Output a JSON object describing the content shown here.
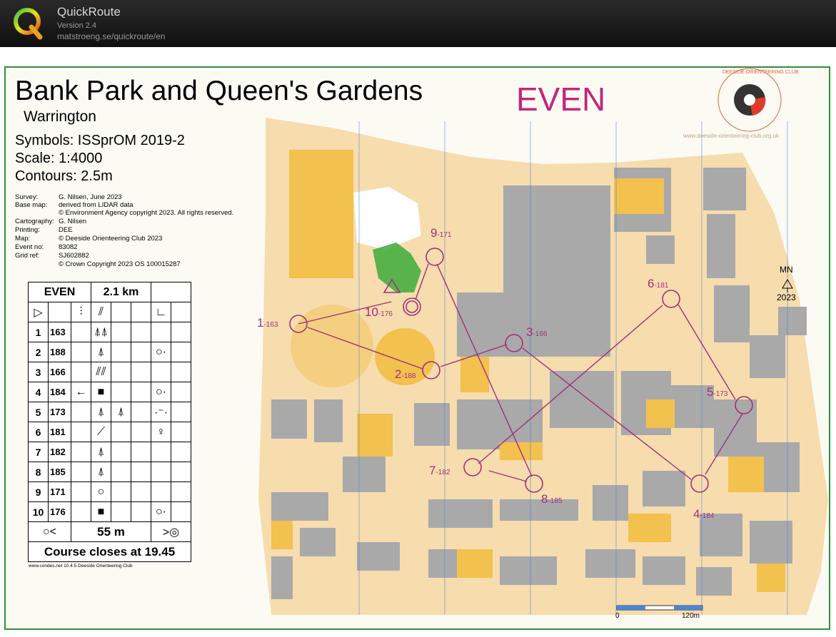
{
  "app": {
    "title": "QuickRoute",
    "version": "Version 2.4",
    "url": "matstroeng.se/quickroute/en",
    "logo_icon": "quickroute-q-logo-icon"
  },
  "map": {
    "title": "Bank Park and Queen's Gardens",
    "subtitle": "Warrington",
    "course_name": "EVEN",
    "symbols": "Symbols:  ISSprOM 2019-2",
    "scale": "Scale:       1:4000",
    "contours": "Contours: 2.5m",
    "club_logo": "deeside-orienteering-club-logo-icon",
    "club_logo_text": "DEESIDE ORIENTEERING CLUB",
    "club_url": "www.deeside-orienteering-club.org.uk",
    "north_label": "MN",
    "north_year": "2023",
    "scale_bar_start": "0",
    "scale_bar_end": "120m",
    "meta": [
      {
        "key": "Survey:",
        "value": "G. Nilsen, June 2023"
      },
      {
        "key": "Base map:",
        "value": "derived from LIDAR data"
      },
      {
        "key": "",
        "value": "© Environment Agency copyright 2023. All rights reserved."
      },
      {
        "key": "Cartography:",
        "value": "G. Nilsen"
      },
      {
        "key": "Printing:",
        "value": "DEE"
      },
      {
        "key": "Map:",
        "value": "© Deeside Orienteering Club 2023"
      },
      {
        "key": "Event no:",
        "value": "83082"
      },
      {
        "key": "Grid ref:",
        "value": "SJ602882"
      },
      {
        "key": "",
        "value": "© Crown Copyright 2023 OS 100015287"
      }
    ],
    "colors": {
      "paved": "#f7dcae",
      "open": "#f2c14e",
      "building": "#a9a9a9",
      "course": "#a0307a",
      "green": "#3cab3c",
      "frame": "#2f8f3c"
    }
  },
  "controls": [
    {
      "num": "1",
      "code": "-163"
    },
    {
      "num": "2",
      "code": "-188"
    },
    {
      "num": "3",
      "code": "-166"
    },
    {
      "num": "4",
      "code": "-184"
    },
    {
      "num": "5",
      "code": "-173"
    },
    {
      "num": "6",
      "code": "-181"
    },
    {
      "num": "7",
      "code": "-182"
    },
    {
      "num": "8",
      "code": "-185"
    },
    {
      "num": "9",
      "code": "-171"
    },
    {
      "num": "10",
      "code": "-176"
    }
  ],
  "description": {
    "course": "EVEN",
    "length": "2.1 km",
    "rows": [
      {
        "n": "1",
        "code": "163",
        "arrow": "",
        "feature": "⍋⍋",
        "extra": "",
        "loc": ""
      },
      {
        "n": "2",
        "code": "188",
        "arrow": "",
        "feature": "⍋",
        "extra": "",
        "loc": "○·"
      },
      {
        "n": "3",
        "code": "166",
        "arrow": "",
        "feature": "⫽⫽",
        "extra": "",
        "loc": ""
      },
      {
        "n": "4",
        "code": "184",
        "arrow": "←",
        "feature": "■",
        "extra": "",
        "loc": "○·"
      },
      {
        "n": "5",
        "code": "173",
        "arrow": "",
        "feature": "⍋",
        "extra": "⍋",
        "loc": "·⁻·"
      },
      {
        "n": "6",
        "code": "181",
        "arrow": "",
        "feature": "⟋",
        "extra": "",
        "loc": "♀"
      },
      {
        "n": "7",
        "code": "182",
        "arrow": "",
        "feature": "⍋",
        "extra": "",
        "loc": ""
      },
      {
        "n": "8",
        "code": "185",
        "arrow": "",
        "feature": "⍋",
        "extra": "",
        "loc": ""
      },
      {
        "n": "9",
        "code": "171",
        "arrow": "",
        "feature": "○",
        "extra": "",
        "loc": ""
      },
      {
        "n": "10",
        "code": "176",
        "arrow": "",
        "feature": "■",
        "extra": "",
        "loc": "○·"
      }
    ],
    "finish_distance": "55 m",
    "closes": "Course closes at 19.45",
    "condes_note": "www.condes.net 10.4.5 Deeside Orienteering Club"
  }
}
